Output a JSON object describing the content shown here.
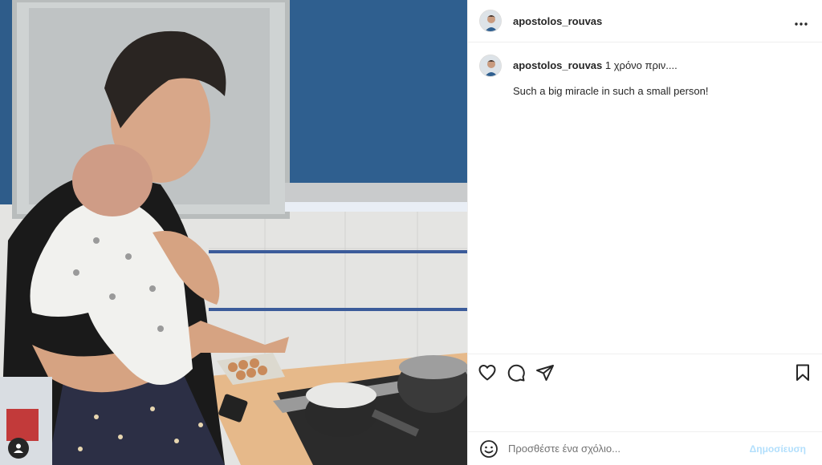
{
  "post": {
    "username": "apostolos_rouvas",
    "time_ago": "1 χρόνο πριν....",
    "caption": "Such a big miracle in such a small person!"
  },
  "icons": {
    "more": "more-options-icon",
    "like": "heart-icon",
    "comment": "comment-icon",
    "share": "share-icon",
    "save": "bookmark-icon",
    "emoji": "emoji-icon",
    "tag": "user-tag-icon"
  },
  "comment_box": {
    "placeholder": "Προσθέστε ένα σχόλιο...",
    "post_label": "Δημοσίευση"
  },
  "colors": {
    "cabinet_blue": "#2e5c8a",
    "post_button_disabled": "#b2dffc"
  }
}
